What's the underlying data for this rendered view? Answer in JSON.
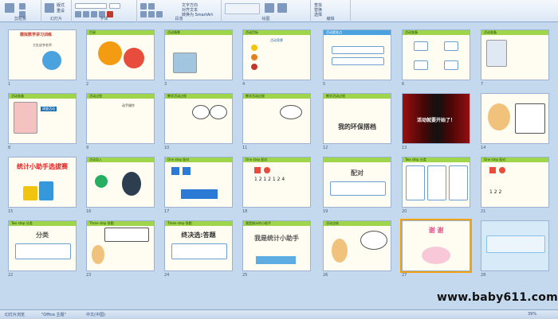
{
  "ribbon": {
    "groups": [
      "剪贴板",
      "幻灯片",
      "字体",
      "段落",
      "绘图",
      "编辑"
    ],
    "items": [
      "版式",
      "重设",
      "删除",
      "新建",
      "文字方向",
      "对齐文本",
      "转换为 SmartArt",
      "查找",
      "替换",
      "选择",
      "快速样式",
      "排列"
    ]
  },
  "slides": [
    {
      "n": "1",
      "title": "模拟数学讲习训练",
      "big": "大肚皮李老师",
      "big2": "统计"
    },
    {
      "n": "2",
      "title": "目录",
      "big": ""
    },
    {
      "n": "3",
      "title": "活动情景",
      "big": ""
    },
    {
      "n": "4",
      "title": "活动目标",
      "big": "活动背景"
    },
    {
      "n": "5",
      "title": "活动要准点",
      "big": ""
    },
    {
      "n": "6",
      "title": "活动准备",
      "big": "交叉问答"
    },
    {
      "n": "7",
      "title": "活动准备",
      "big": ""
    },
    {
      "n": "8",
      "title": "活动准备",
      "big": "调查活动"
    },
    {
      "n": "9",
      "title": "活动过程",
      "big": "动手操作"
    },
    {
      "n": "10",
      "title": "教学活动过程",
      "big": ""
    },
    {
      "n": "11",
      "title": "教学活动过程",
      "big": ""
    },
    {
      "n": "12",
      "title": "教学活动过程",
      "big": "我的环保搭档"
    },
    {
      "n": "13",
      "title": "",
      "big": "活动就要开始了！"
    },
    {
      "n": "14",
      "title": "",
      "big": ""
    },
    {
      "n": "15",
      "title": "",
      "big": "统计小助手选拔赛"
    },
    {
      "n": "16",
      "title": "活动导入",
      "big": ""
    },
    {
      "n": "17",
      "title": "One step 配对",
      "big": ""
    },
    {
      "n": "18",
      "title": "One step 配对",
      "big": "1 2 1 2 1 2 4"
    },
    {
      "n": "19",
      "title": "",
      "big": "配对"
    },
    {
      "n": "20",
      "title": "Two step 分类",
      "big": ""
    },
    {
      "n": "21",
      "title": "One step 配对",
      "big": "1 2 2"
    },
    {
      "n": "22",
      "title": "Two step 分类",
      "big": "分类"
    },
    {
      "n": "23",
      "title": "Three step 答题",
      "big": ""
    },
    {
      "n": "24",
      "title": "Three step 答题",
      "big": "终决选:答题"
    },
    {
      "n": "25",
      "title": "我是统计的小助手",
      "big": "我是统计小助手"
    },
    {
      "n": "26",
      "title": "活动总结",
      "big": ""
    },
    {
      "n": "27",
      "title": "",
      "big": "谢 谢"
    },
    {
      "n": "28",
      "title": "",
      "big": ""
    }
  ],
  "status": {
    "slide_info": "幻灯片浏览",
    "theme": "\"Office 主题\"",
    "lang": "中文(中国)",
    "zoom": "39%"
  },
  "watermark": "www.baby611.com",
  "colors": {
    "accent": "#9fd54a",
    "selection": "#f3a20b",
    "ribbon": "#dbe7f5"
  }
}
